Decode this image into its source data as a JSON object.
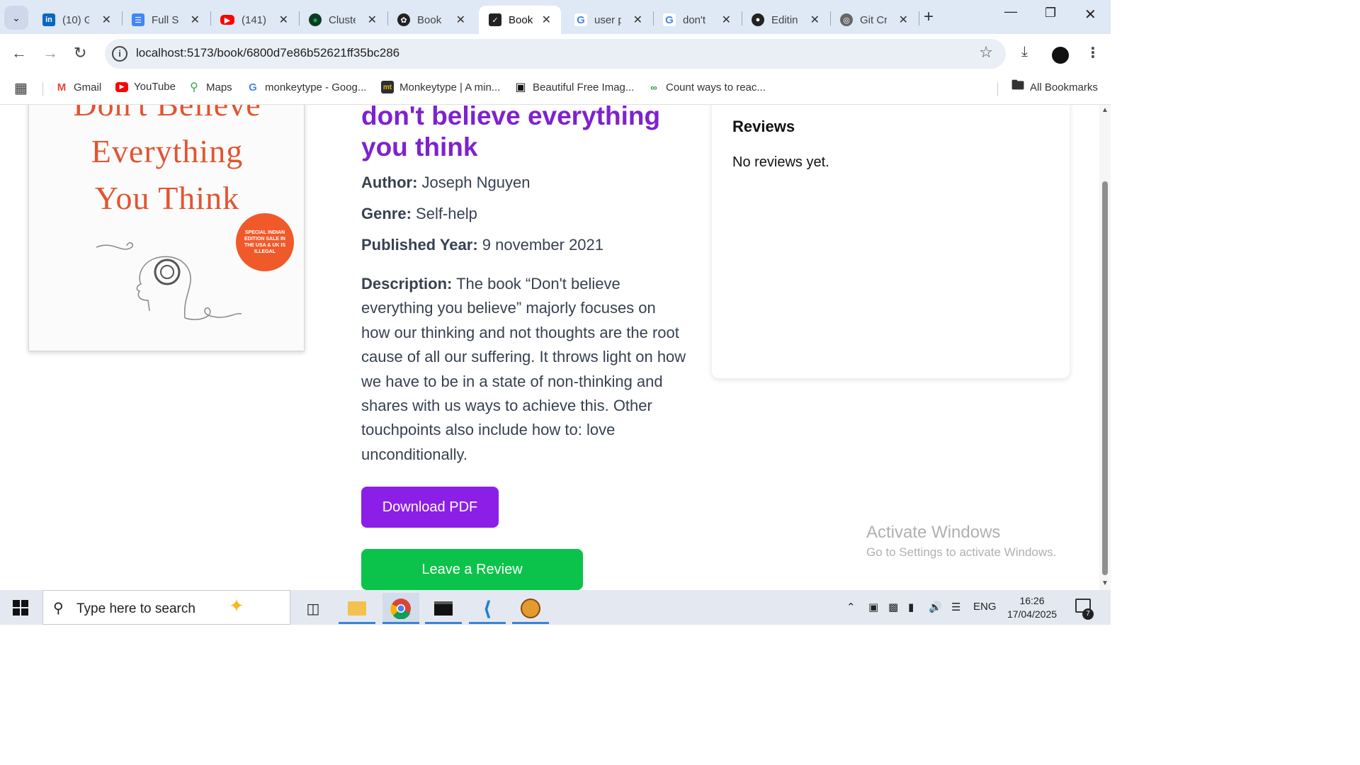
{
  "browser": {
    "tabs": [
      {
        "title": "(10) G",
        "favicon": "linkedin-icon",
        "color": "#0a66c2"
      },
      {
        "title": "Full St",
        "favicon": "docs-icon",
        "color": "#4285f4"
      },
      {
        "title": "(141)",
        "favicon": "youtube-icon",
        "color": "#ff0000"
      },
      {
        "title": "Cluste",
        "favicon": "mongodb-icon",
        "color": "#13aa52"
      },
      {
        "title": "Book",
        "favicon": "openai-icon",
        "color": "#222222"
      },
      {
        "title": "Book",
        "favicon": "bookapp-icon",
        "color": "#222222",
        "active": true
      },
      {
        "title": "user p",
        "favicon": "google-icon",
        "color": "#4285f4"
      },
      {
        "title": "don't",
        "favicon": "google-icon",
        "color": "#4285f4"
      },
      {
        "title": "Editin",
        "favicon": "github-icon",
        "color": "#222222"
      },
      {
        "title": "Git Cr",
        "favicon": "globe-icon",
        "color": "#555555"
      }
    ],
    "url": "localhost:5173/book/6800d7e86b52621ff35bc286",
    "bookmarks": [
      {
        "label": "Gmail",
        "icon": "gmail-icon"
      },
      {
        "label": "YouTube",
        "icon": "youtube-icon"
      },
      {
        "label": "Maps",
        "icon": "maps-icon"
      },
      {
        "label": "monkeytype - Goog...",
        "icon": "google-icon"
      },
      {
        "label": "Monkeytype | A min...",
        "icon": "monkeytype-icon"
      },
      {
        "label": "Beautiful Free Imag...",
        "icon": "unsplash-icon"
      },
      {
        "label": "Count ways to reac...",
        "icon": "geeksforgeeks-icon"
      }
    ],
    "all_bookmarks": "All Bookmarks"
  },
  "book": {
    "cover_lines": [
      "Don't Believe",
      "Everything",
      "You Think"
    ],
    "cover_badge": "SPECIAL INDIAN EDITION SALE IN THE USA & UK IS ILLEGAL",
    "title": "don't believe everything you think",
    "author_label": "Author:",
    "author": "Joseph Nguyen",
    "genre_label": "Genre:",
    "genre": "Self-help",
    "year_label": "Published Year:",
    "year": "9 november 2021",
    "description_label": "Description:",
    "description": "The book “Don't believe everything you believe” majorly focuses on how our thinking and not thoughts are the root cause of all our suffering. It throws light on how we have to be in a state of non-thinking and shares with us ways to achieve this. Other touchpoints also include how to: love unconditionally.",
    "download_label": "Download PDF",
    "review_label": "Leave a Review"
  },
  "reviews": {
    "heading": "Reviews",
    "empty": "No reviews yet."
  },
  "watermark": {
    "line1": "Activate Windows",
    "line2": "Go to Settings to activate Windows."
  },
  "taskbar": {
    "search_placeholder": "Type here to search",
    "language": "ENG",
    "time": "16:26",
    "date": "17/04/2025",
    "notifications": "7"
  },
  "colors": {
    "title": "#7e22ce",
    "download_button": "#8b1fe8",
    "review_button": "#0bc34a"
  }
}
